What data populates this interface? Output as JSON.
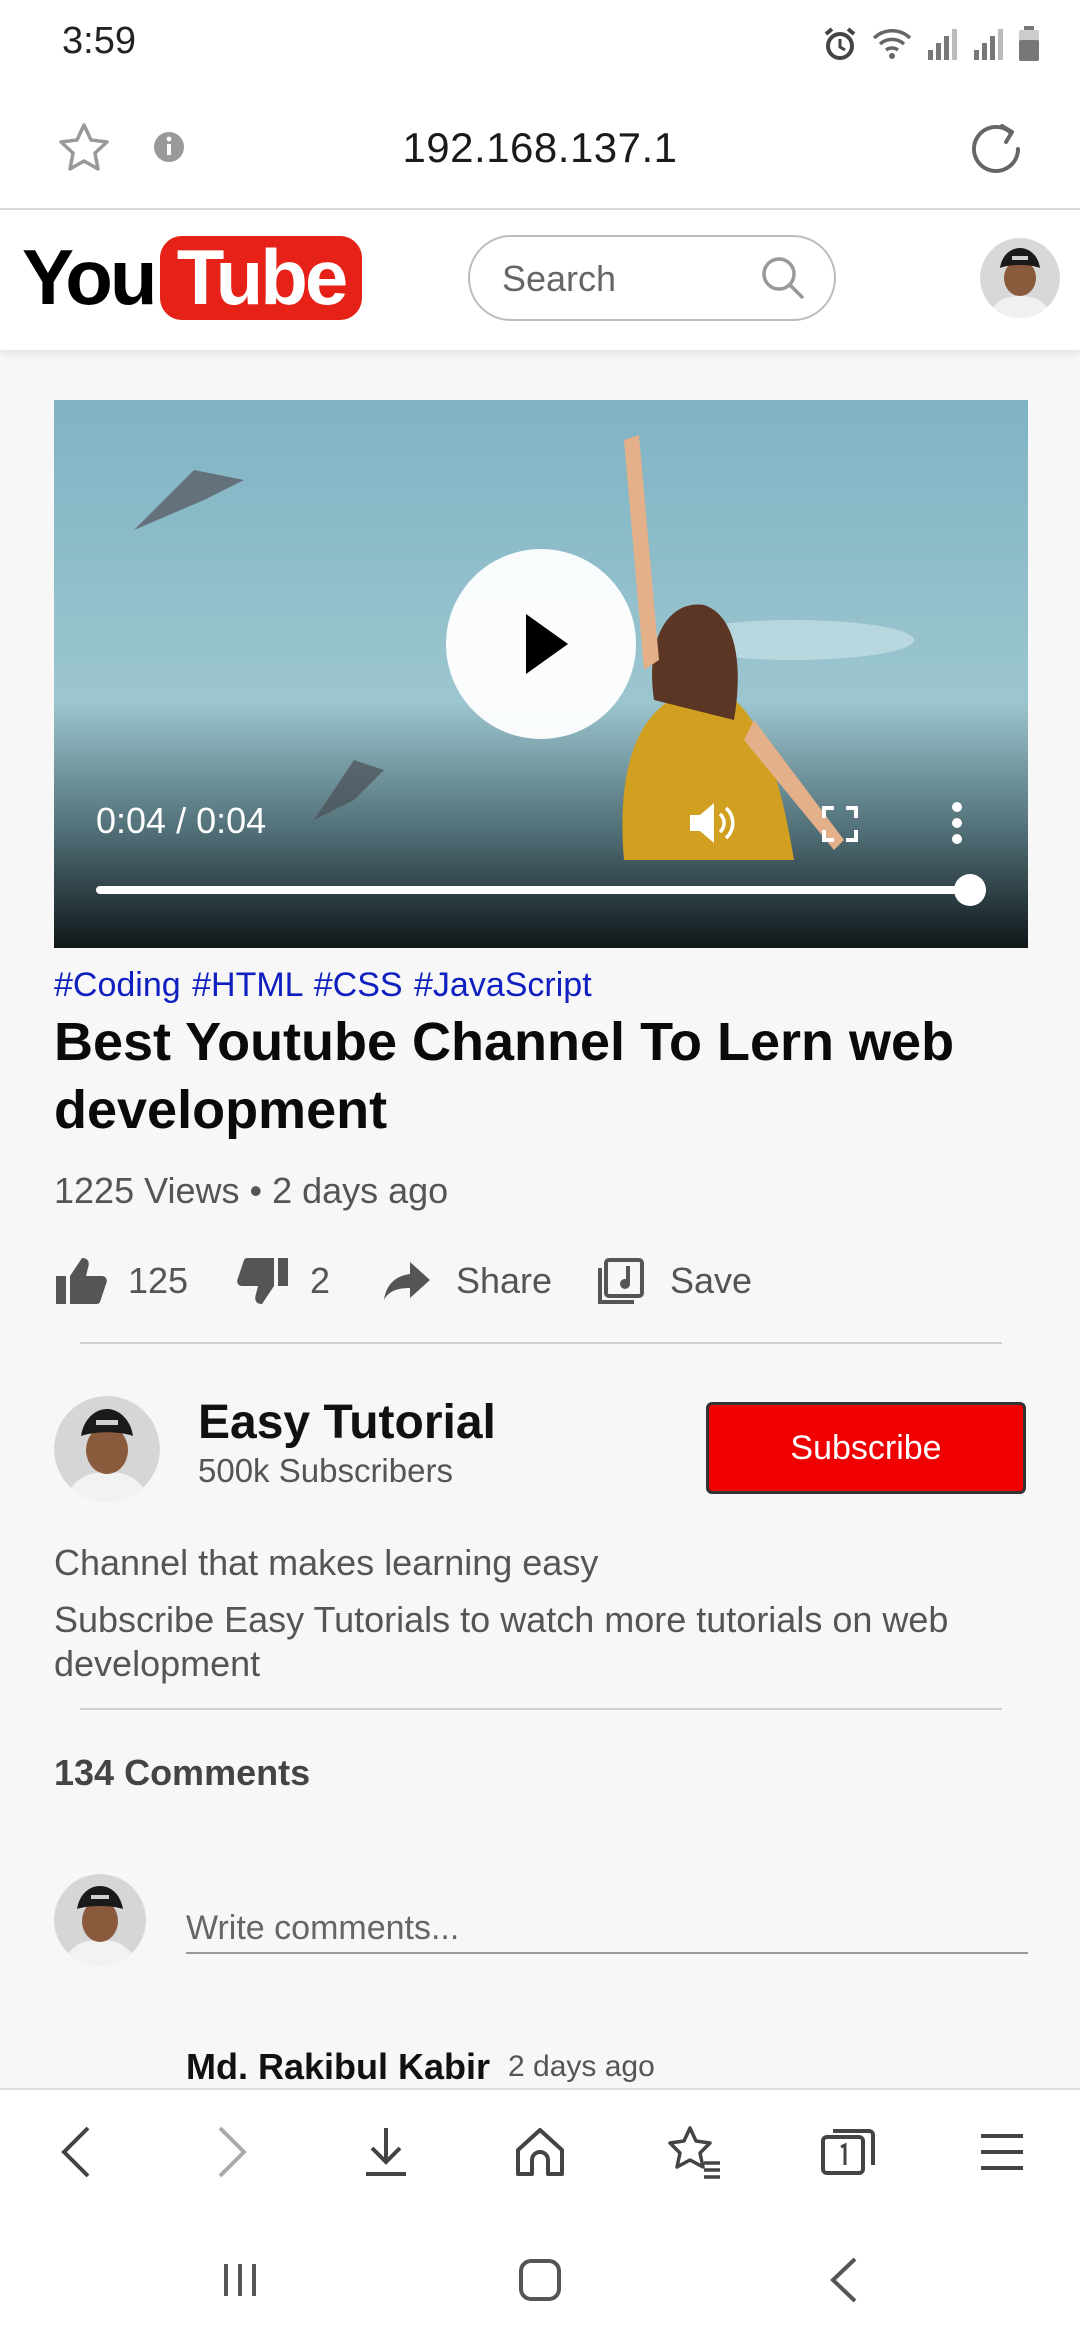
{
  "status_bar": {
    "time": "3:59"
  },
  "browser": {
    "url": "192.168.137.1"
  },
  "header": {
    "logo_you": "You",
    "logo_tube": "Tube",
    "search_placeholder": "Search"
  },
  "video": {
    "time": "0:04 / 0:04",
    "progress_fraction": 1.0
  },
  "tags": "#Coding #HTML #CSS #JavaScript",
  "title": "Best Youtube Channel To Lern web development",
  "meta": "1225 Views • 2 days ago",
  "actions": {
    "likes": "125",
    "dislikes": "2",
    "share": "Share",
    "save": "Save"
  },
  "channel": {
    "name": "Easy Tutorial",
    "subscribers": "500k Subscribers",
    "subscribe_label": "Subscribe",
    "description_1": "Channel that makes learning easy",
    "description_2": "Subscribe Easy Tutorials to watch more tutorials on web development"
  },
  "comments": {
    "count_label": "134 Comments",
    "input_placeholder": "Write comments...",
    "first_author": "Md. Rakibul Kabir",
    "first_time": "2 days ago"
  },
  "colors": {
    "brand_red": "#e62117",
    "subscribe_red": "#f00000",
    "tag_blue": "#1020c0"
  }
}
